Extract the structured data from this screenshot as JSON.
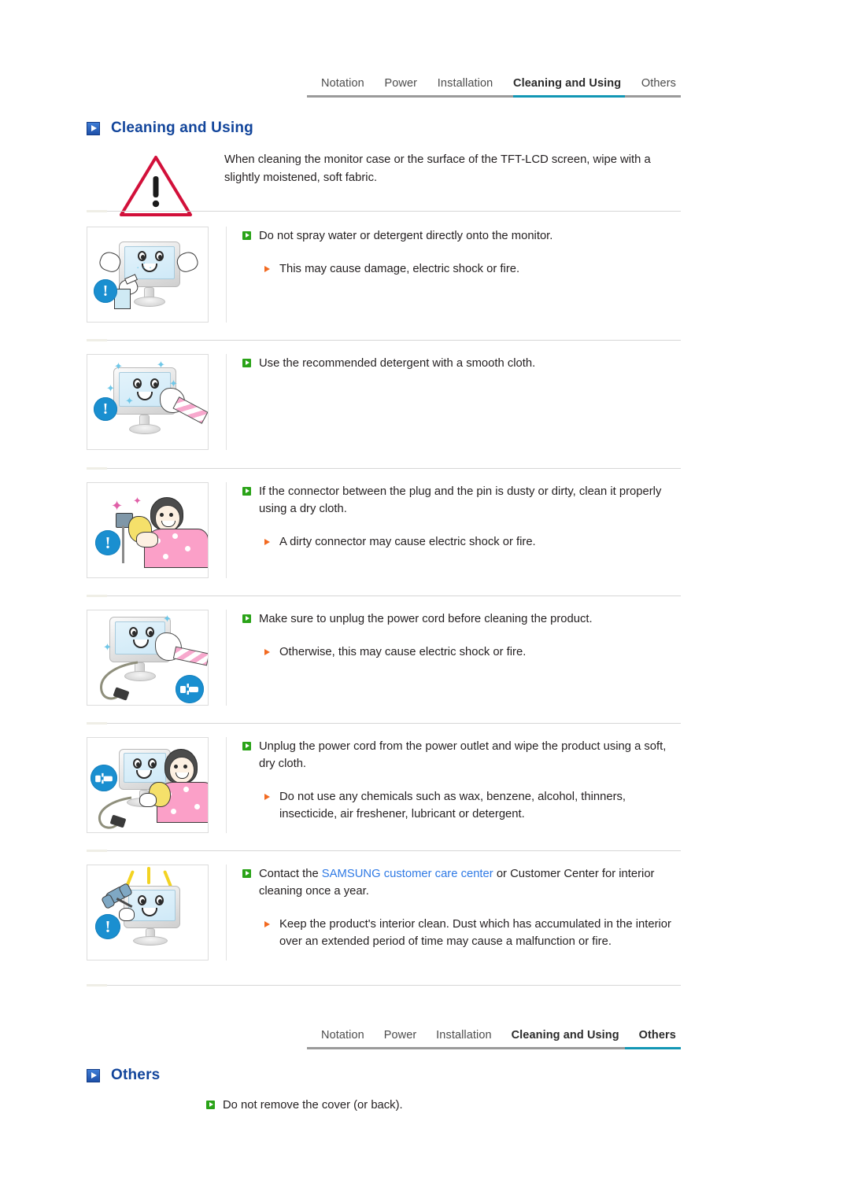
{
  "nav_top": {
    "items": [
      {
        "label": "Notation",
        "active": false
      },
      {
        "label": "Power",
        "active": false
      },
      {
        "label": "Installation",
        "active": false
      },
      {
        "label": "Cleaning and Using",
        "active": true
      },
      {
        "label": "Others",
        "active": false
      }
    ],
    "active_color": "#1296b4"
  },
  "nav_bottom": {
    "items": [
      {
        "label": "Notation",
        "active": false
      },
      {
        "label": "Power",
        "active": false
      },
      {
        "label": "Installation",
        "active": false
      },
      {
        "label": "Cleaning and Using",
        "active": false
      },
      {
        "label": "Others",
        "active": true
      }
    ],
    "active_color": "#1296b4"
  },
  "sections": {
    "cleaning": {
      "title": "Cleaning and Using",
      "title_color": "#12459b"
    },
    "others": {
      "title": "Others",
      "title_color": "#12459b",
      "item": "Do not remove the cover (or back)."
    }
  },
  "warning": {
    "icon": "warning-triangle-icon",
    "text": "When cleaning the monitor case or the surface of the TFT-LCD screen, wipe with a slightly moistened, soft fabric."
  },
  "items": [
    {
      "illustration": "monitor-spray-warning-illustration",
      "main": "Do not spray water or detergent directly onto the monitor.",
      "subs": [
        "This may cause damage, electric shock or fire."
      ]
    },
    {
      "illustration": "monitor-wipe-cloth-illustration",
      "main": "Use the recommended detergent with a smooth cloth.",
      "subs": []
    },
    {
      "illustration": "person-cleaning-plug-illustration",
      "main": "If the connector between the plug and the pin is dusty or dirty, clean it properly using a dry cloth.",
      "subs": [
        "A dirty connector may cause electric shock or fire."
      ]
    },
    {
      "illustration": "unplug-before-cleaning-illustration",
      "main": "Make sure to unplug the power cord before cleaning the product.",
      "subs": [
        "Otherwise, this may cause electric shock or fire."
      ]
    },
    {
      "illustration": "person-wiping-unplugged-monitor-illustration",
      "main": "Unplug the power cord from the power outlet and wipe the product using a soft, dry cloth.",
      "subs": [
        "Do not use any chemicals such as wax, benzene, alcohol, thinners, insecticide, air freshener, lubricant or detergent."
      ]
    },
    {
      "illustration": "contact-service-center-illustration",
      "main_prefix": "Contact the ",
      "main_link": "SAMSUNG customer care center",
      "main_suffix": " or Customer Center for interior cleaning once a year.",
      "link_color": "#2f7ae5",
      "subs": [
        "Keep the product's interior clean. Dust which has accumulated in the interior over an extended period of time may cause a malfunction or fire."
      ]
    }
  ],
  "bullets": {
    "main_icon": "green-play-bullet-icon",
    "main_color": "#2aa318",
    "sub_icon": "orange-triangle-bullet-icon",
    "sub_color": "#f26a21"
  }
}
